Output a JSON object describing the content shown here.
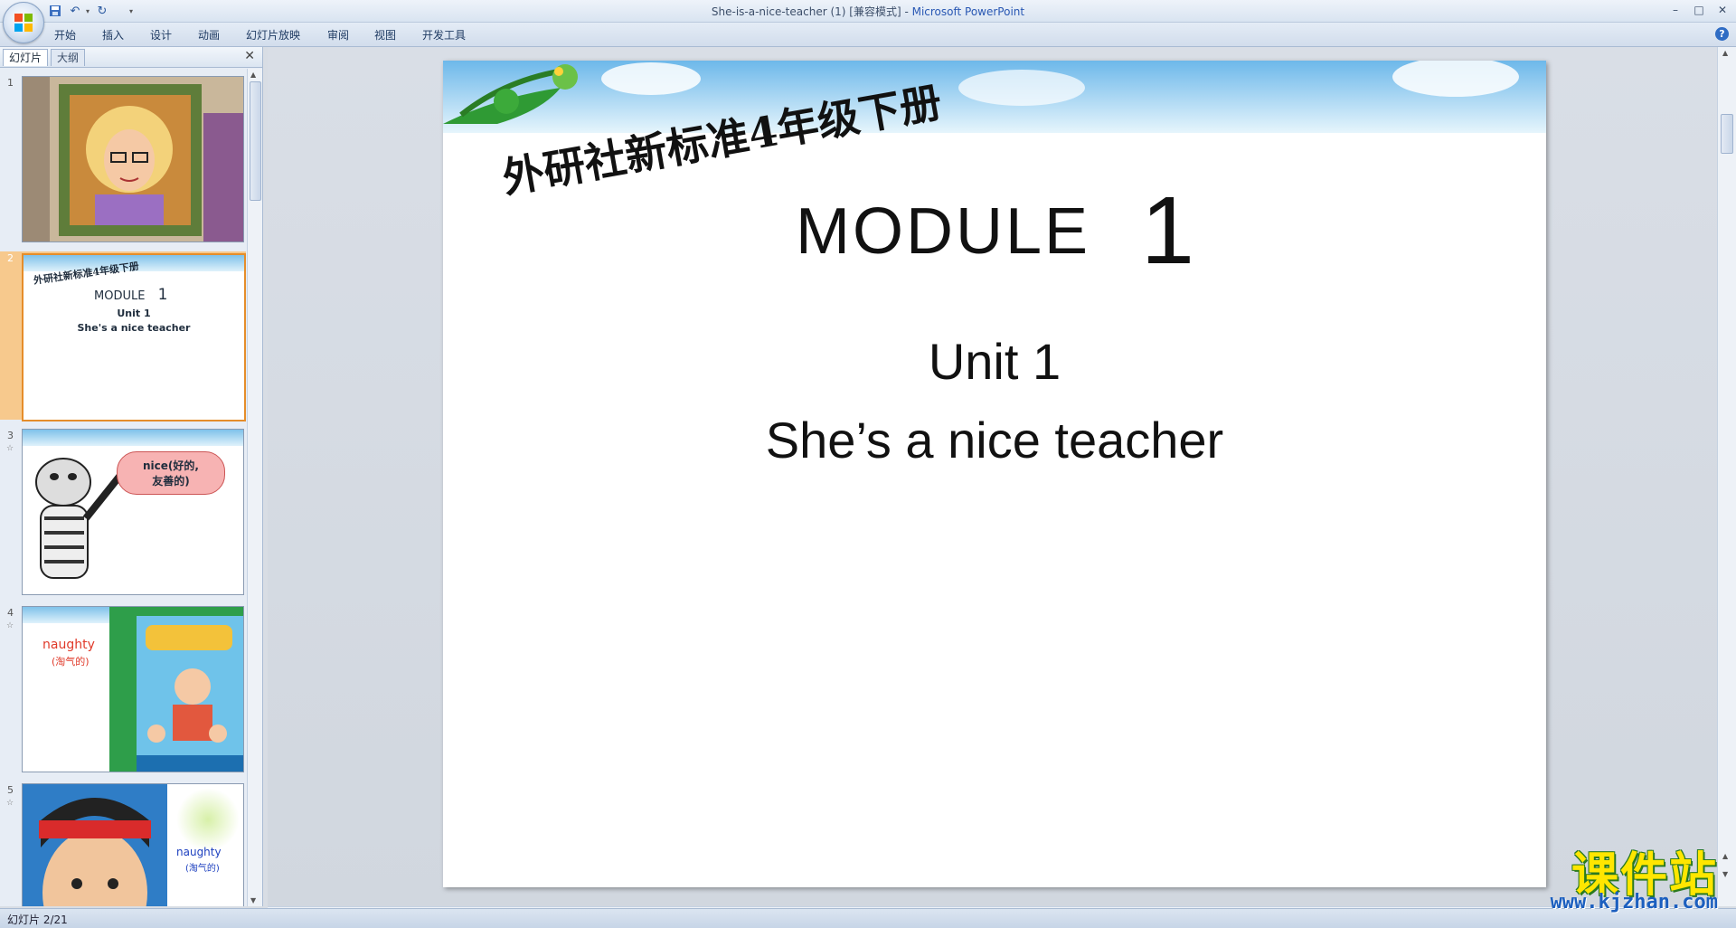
{
  "window": {
    "title_doc": "She-is-a-nice-teacher (1) [兼容模式] - ",
    "title_app": "Microsoft PowerPoint",
    "minimize": "–",
    "maximize": "□",
    "close": "✕"
  },
  "ribbon": {
    "tabs": [
      "开始",
      "插入",
      "设计",
      "动画",
      "幻灯片放映",
      "审阅",
      "视图",
      "开发工具"
    ]
  },
  "panel": {
    "tab_slides": "幻灯片",
    "tab_outline": "大纲",
    "close": "✕"
  },
  "thumbnails": [
    {
      "num": "1",
      "star": "",
      "text": []
    },
    {
      "num": "2",
      "star": "",
      "title_cn": "外研社新标准4年级下册",
      "module": "MODULE",
      "module_num": "1",
      "unit": "Unit 1",
      "subtitle": "She's a nice teacher"
    },
    {
      "num": "3",
      "star": "☆",
      "bubble_en": "nice(好的,",
      "bubble_cn": "友善的)"
    },
    {
      "num": "4",
      "star": "☆",
      "word": "naughty",
      "word_cn": "(淘气的)"
    },
    {
      "num": "5",
      "star": "☆",
      "word": "naughty",
      "word_cn": "(淘气的)"
    }
  ],
  "slide": {
    "title_cn": "外研社新标准4年级下册",
    "module": "MODULE",
    "module_num": "1",
    "unit": "Unit 1",
    "subtitle": "She’s a nice teacher"
  },
  "status": {
    "slide_indicator": "幻灯片 2/21"
  },
  "watermark": {
    "cn": "课件站",
    "url": "www.kjzhan.com"
  },
  "colors": {
    "accent_orange": "#e58d2a",
    "title_blue": "#2857b3",
    "watermark_yellow": "#ffe600"
  }
}
